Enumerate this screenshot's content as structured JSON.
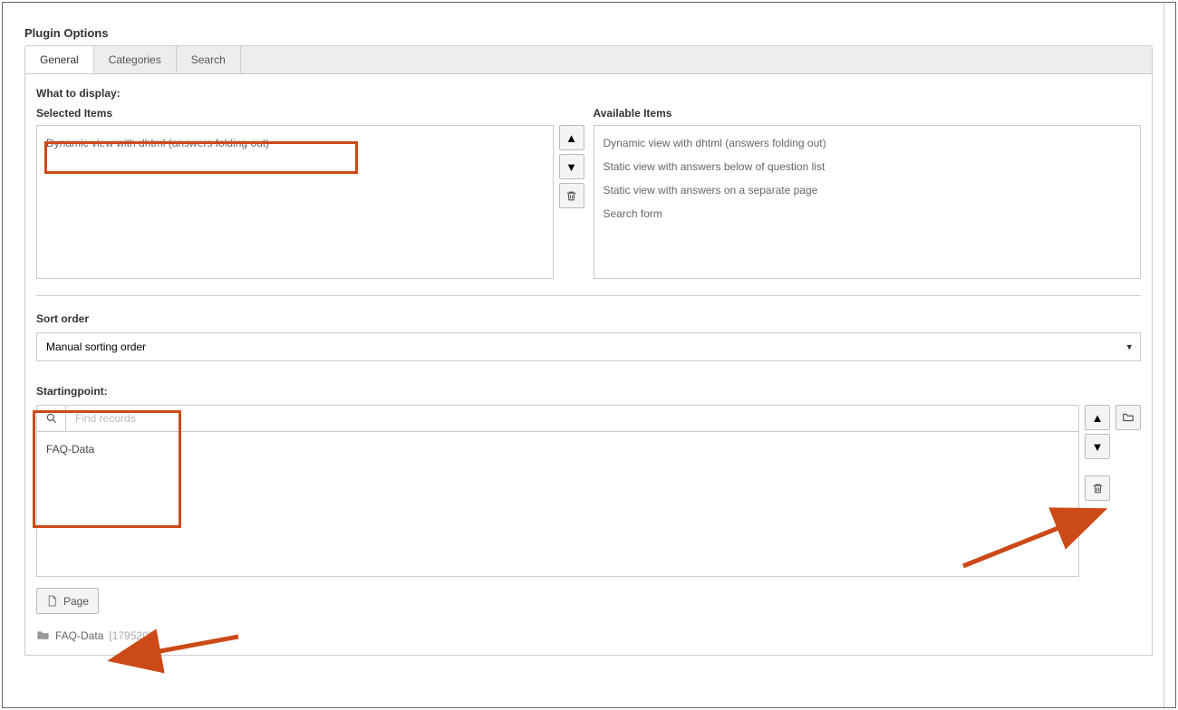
{
  "header": {
    "title": "Plugin Options"
  },
  "tabs": [
    {
      "label": "General",
      "active": true
    },
    {
      "label": "Categories",
      "active": false
    },
    {
      "label": "Search",
      "active": false
    }
  ],
  "display": {
    "section_label": "What to display:",
    "selected_label": "Selected Items",
    "available_label": "Available Items",
    "selected_items": [
      "Dynamic view with dhtml (answers folding out)"
    ],
    "available_items": [
      "Dynamic view with dhtml (answers folding out)",
      "Static view with answers below of question list",
      "Static view with answers on a separate page",
      "Search form"
    ]
  },
  "sort": {
    "label": "Sort order",
    "value": "Manual sorting order"
  },
  "starting": {
    "label": "Startingpoint:",
    "search_placeholder": "Find records",
    "records": [
      "FAQ-Data"
    ],
    "page_button_label": "Page",
    "result_label": "FAQ-Data",
    "result_id": "[179520]"
  },
  "highlight_color": "#cc4a17"
}
